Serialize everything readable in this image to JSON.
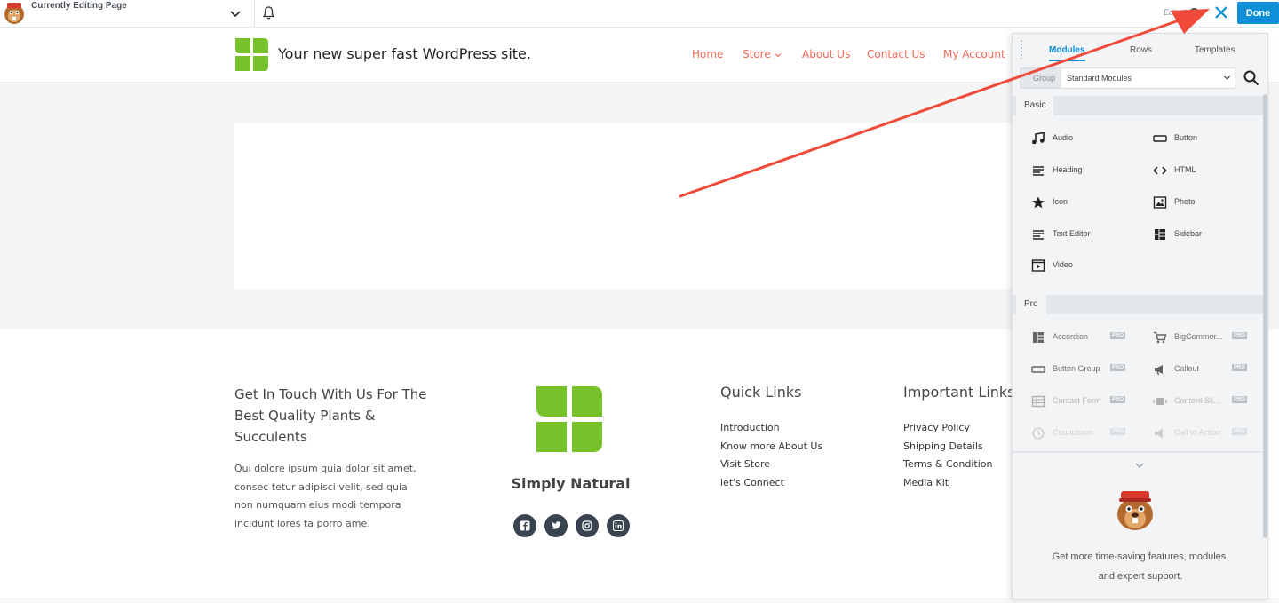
{
  "topbar": {
    "editing_label": "Currently Editing Page",
    "edited_label": "Edited",
    "help_glyph": "?",
    "done_label": "Done",
    "icons": [
      "beaver-logo-icon",
      "chevron-down-icon",
      "bell-icon",
      "help-icon",
      "close-icon"
    ]
  },
  "site": {
    "title": "Your new super fast WordPress site.",
    "nav": [
      "Home",
      "Store",
      "About Us",
      "Contact Us",
      "My Account"
    ],
    "nav_color": "#ef6a5a",
    "logo_color": "#77c22a"
  },
  "footer": {
    "heading": "Get In Touch With Us For The Best Quality Plants & Succulents",
    "paragraph": "Qui dolore ipsum quia dolor sit amet, consec tetur adipisci velit, sed quia non numquam eius modi tempora incidunt lores ta porro ame.",
    "brand": "Simply Natural",
    "social": [
      "facebook-icon",
      "twitter-icon",
      "instagram-icon",
      "linkedin-icon"
    ],
    "quick_links": {
      "title": "Quick Links",
      "items": [
        "Introduction",
        "Know more About Us",
        "Visit Store",
        "let's Connect"
      ]
    },
    "important_links": {
      "title": "Important Links",
      "items": [
        "Privacy Policy",
        "Shipping Details",
        "Terms & Condition",
        "Media Kit"
      ]
    }
  },
  "panel": {
    "tabs": [
      "Modules",
      "Rows",
      "Templates"
    ],
    "active_tab": "Modules",
    "group_label": "Group",
    "group_value": "Standard Modules",
    "basic_label": "Basic",
    "basic_modules": [
      "Audio",
      "Button",
      "Heading",
      "HTML",
      "Icon",
      "Photo",
      "Text Editor",
      "Sidebar",
      "Video"
    ],
    "pro_label": "Pro",
    "pro_badge": "PRO",
    "pro_modules": [
      "Accordion",
      "BigCommer...",
      "Button Group",
      "Callout",
      "Contact Form",
      "Content Sli...",
      "Countdown",
      "Call to Action"
    ],
    "promo_text": "Get more time-saving features, modules, and expert support.",
    "accent": "#0e8fd6"
  },
  "annotation": {
    "arrow_color": "#f04a3a"
  }
}
